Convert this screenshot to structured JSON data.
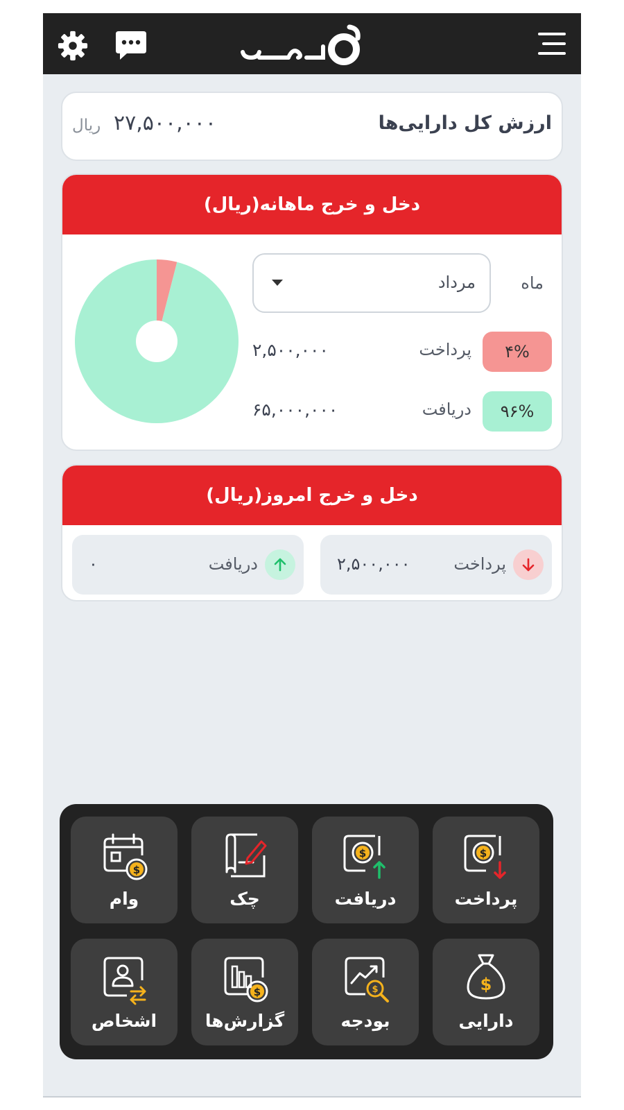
{
  "header": {
    "logo_icon": "app-logo",
    "settings_icon": "gear-icon",
    "chat_icon": "chat-icon",
    "menu_icon": "hamburger-menu-icon"
  },
  "total_assets": {
    "label": "ارزش کل دارایی‌ها",
    "value": "۲۷,۵۰۰,۰۰۰",
    "unit": "ریال"
  },
  "monthly": {
    "title": "دخل و خرج ماهانه(ریال)",
    "month_label": "ماه",
    "month_value": "مرداد",
    "payment": {
      "label": "پرداخت",
      "percent": "۴%",
      "amount": "۲,۵۰۰,۰۰۰"
    },
    "receipt": {
      "label": "دریافت",
      "percent": "۹۶%",
      "amount": "۶۵,۰۰۰,۰۰۰"
    }
  },
  "chart_data": {
    "type": "pie",
    "categories": [
      "پرداخت",
      "دریافت"
    ],
    "values": [
      4,
      96
    ],
    "colors": [
      "#f59593",
      "#a8f0d3"
    ]
  },
  "today": {
    "title": "دخل و خرج امروز(ریال)",
    "payment": {
      "label": "پرداخت",
      "amount": "۲,۵۰۰,۰۰۰"
    },
    "receipt": {
      "label": "دریافت",
      "amount": "۰"
    }
  },
  "actions": {
    "payment": "پرداخت",
    "receipt": "دریافت",
    "cheque": "چک",
    "loan": "وام",
    "assets": "دارایی",
    "budget": "بودجه",
    "reports": "گزارش‌ها",
    "persons": "اشخاص"
  },
  "colors": {
    "brand_red": "#e5252a",
    "dark": "#222222",
    "tile": "#3e3e3e",
    "accent_yellow": "#f5b21c",
    "payment_red": "#e5252a",
    "receipt_green": "#1fbf6b"
  }
}
